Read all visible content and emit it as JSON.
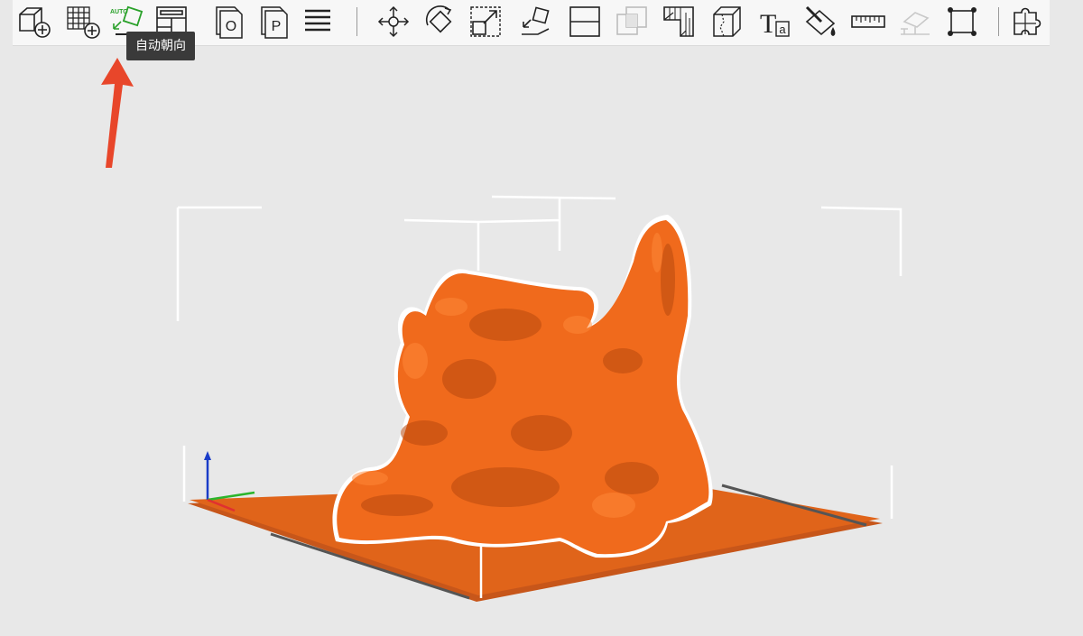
{
  "toolbar": {
    "tooltip": "自动朝向",
    "auto_badge": "AUTO",
    "buttons": [
      {
        "name": "add-model",
        "label": "Add model"
      },
      {
        "name": "add-grid-model",
        "label": "Add grid model"
      },
      {
        "name": "auto-orient",
        "label": "Auto orientation"
      },
      {
        "name": "auto-layout",
        "label": "Auto layout"
      },
      {
        "name": "page-o",
        "label": "O"
      },
      {
        "name": "page-p",
        "label": "P"
      },
      {
        "name": "slice-list",
        "label": "Layers"
      },
      {
        "name": "move",
        "label": "Move"
      },
      {
        "name": "rotate",
        "label": "Rotate"
      },
      {
        "name": "scale",
        "label": "Scale"
      },
      {
        "name": "place-on-face",
        "label": "Place on face"
      },
      {
        "name": "cut",
        "label": "Cut"
      },
      {
        "name": "boolean",
        "label": "Boolean"
      },
      {
        "name": "hollow",
        "label": "Hollow"
      },
      {
        "name": "split",
        "label": "Split"
      },
      {
        "name": "text",
        "label": "Text",
        "glyph": "T",
        "sub": "a"
      },
      {
        "name": "paint",
        "label": "Paint"
      },
      {
        "name": "measure",
        "label": "Measure"
      },
      {
        "name": "support",
        "label": "Support"
      },
      {
        "name": "fit-frame",
        "label": "Fit"
      },
      {
        "name": "puzzle",
        "label": "Plugins"
      }
    ]
  },
  "colors": {
    "model": "#f06a1c",
    "model_shadow": "#b8480e",
    "plate": "#e0641a",
    "plate_edge": "#c7561a",
    "frame": "#ffffff",
    "arrow": "#e8462a",
    "axis_z": "#1a3cc8",
    "axis_y": "#2bb52b",
    "axis_x": "#e03030"
  }
}
